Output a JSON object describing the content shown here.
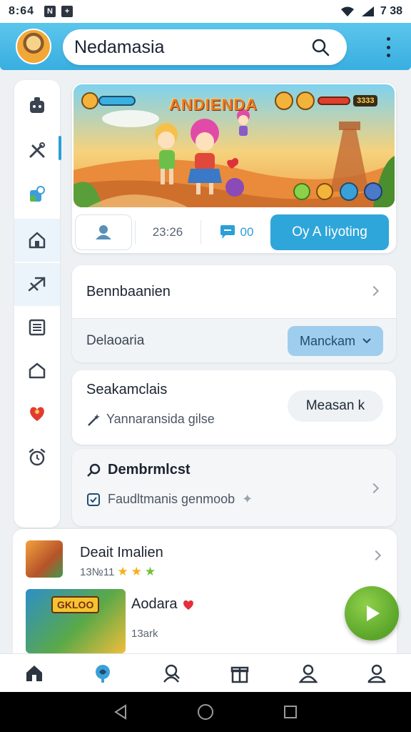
{
  "status_bar": {
    "time": "8:64",
    "icon_left_1": "N",
    "icon_left_2": "+",
    "battery_text": "7 38"
  },
  "app_bar": {
    "title": "Nedamasia"
  },
  "hero": {
    "game_title": "ANDIENDA",
    "hud_score": "3333",
    "stat_count": "23:26",
    "chat_count": "00",
    "primary_button": "Oy A Iiyoting"
  },
  "card_1": {
    "title": "Bennbaanien",
    "row_label": "Delaoaria",
    "dropdown_value": "Manckam"
  },
  "card_2": {
    "title": "Seakamclais",
    "subtitle": "Yannaransida gilse",
    "button_label": "Measan k"
  },
  "card_3": {
    "title": "Dembrmlcst",
    "subtitle": "Faudltmanis genmoob"
  },
  "list": {
    "items": [
      {
        "title": "Deait Imalien",
        "meta": "13№11"
      },
      {
        "title": "Aodara",
        "meta": "13ark",
        "thumb_text": "GKLOO"
      }
    ]
  },
  "icons": {
    "sidebar": [
      "robot-icon",
      "tools-icon",
      "puzzle-icon",
      "home-icon",
      "send-icon",
      "list-icon",
      "house-outline-icon",
      "heart-shield-icon",
      "alarm-icon"
    ],
    "bottom_nav": [
      "home-icon",
      "brain-icon",
      "support-icon",
      "gift-icon",
      "profile-icon",
      "account-icon"
    ]
  },
  "colors": {
    "accent": "#2fa6d9",
    "app_bar": "#4bbce6",
    "fab": "#62ab2e"
  }
}
